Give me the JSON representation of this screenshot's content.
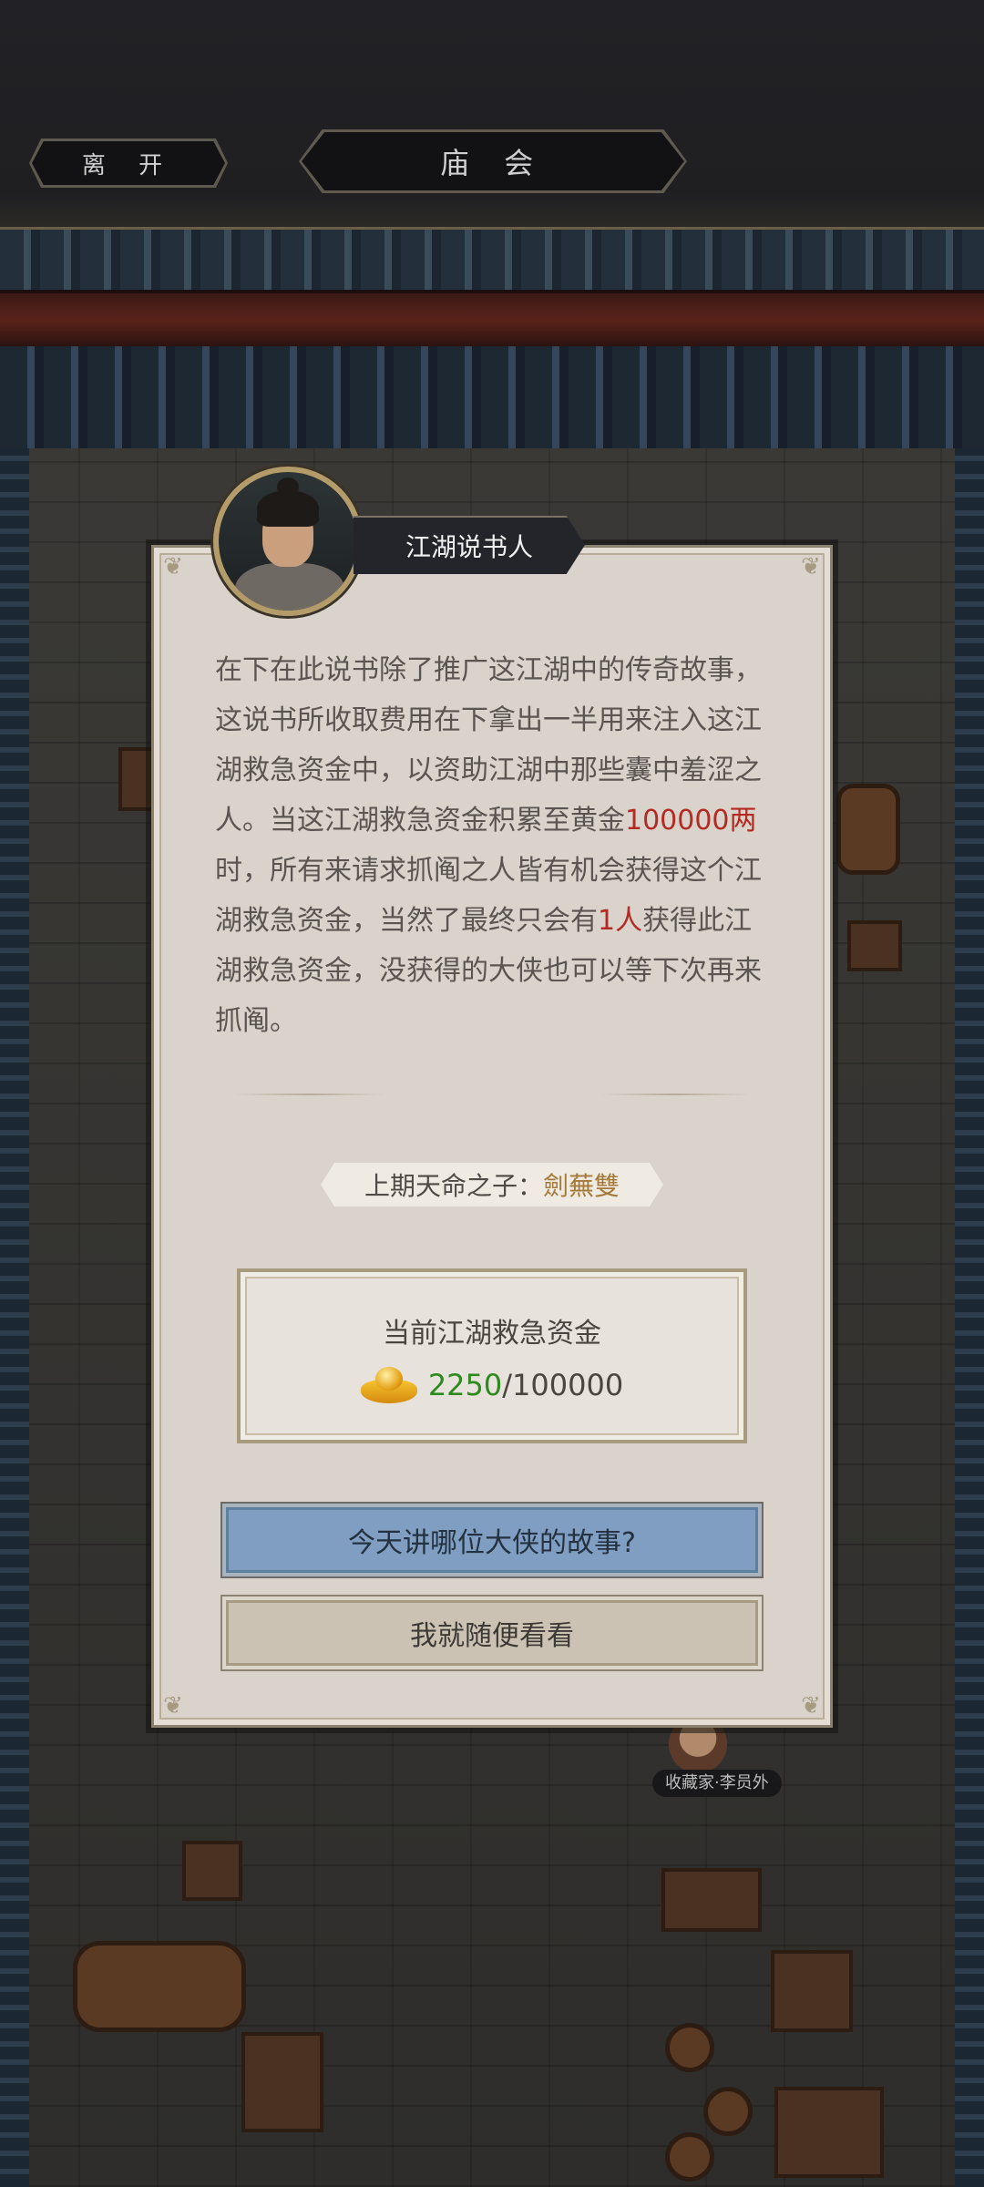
{
  "topbar": {
    "leave_label": "离 开",
    "title": "庙 会"
  },
  "npc": {
    "name": "江湖说书人"
  },
  "story": {
    "part1": "在下在此说书除了推广这江湖中的传奇故事，这说书所收取费用在下拿出一半用来注入这江湖救急资金中，以资助江湖中那些囊中羞涩之人。当这江湖救急资金积累至黄金",
    "highlight_amount": "100000两",
    "part2": "时，所有来请求抓阄之人皆有机会获得这个江湖救急资金，当然了最终只会有",
    "highlight_count": "1人",
    "part3": "获得此江湖救急资金，没获得的大侠也可以等下次再来抓阄。"
  },
  "last_winner": {
    "label": "上期天命之子：",
    "name": "劍蕪雙"
  },
  "fund": {
    "title": "当前江湖救急资金",
    "current": "2250",
    "separator": "/",
    "target": "100000",
    "icon": "gold-ingot-icon",
    "current_color": "#2c8a1e"
  },
  "buttons": {
    "primary_label": "今天讲哪位大侠的故事?",
    "secondary_label": "我就随便看看"
  },
  "background_tags": {
    "collector": "收藏家·李员外"
  },
  "colors": {
    "highlight_red": "#b22a22",
    "winner_gold": "#a57a3a",
    "primary_button": "#7f9ec1",
    "secondary_button": "#cbc2b3"
  }
}
